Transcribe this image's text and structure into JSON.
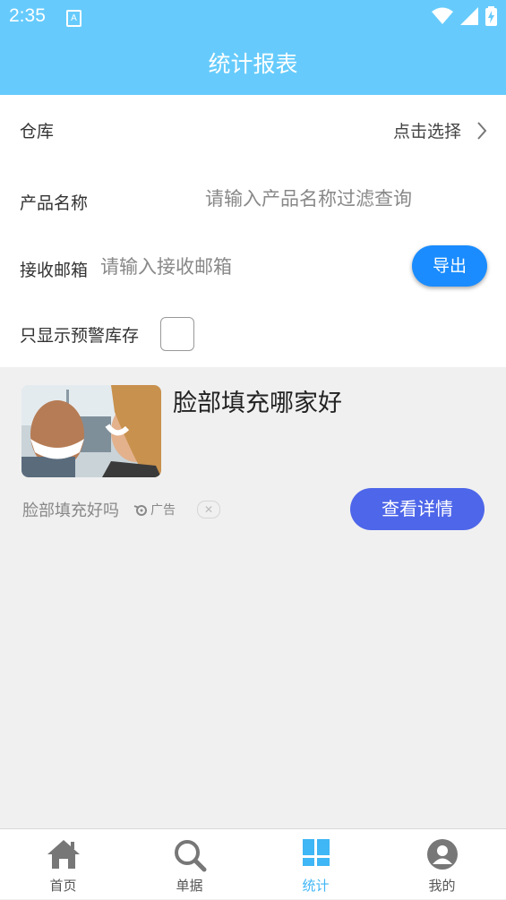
{
  "status_bar": {
    "time": "2:35",
    "notification_letter": "A"
  },
  "app_bar": {
    "title": "统计报表"
  },
  "form": {
    "warehouse": {
      "label": "仓库",
      "value": "点击选择"
    },
    "product_name": {
      "label": "产品名称",
      "placeholder": "请输入产品名称过滤查询"
    },
    "email": {
      "label": "接收邮箱",
      "placeholder": "请输入接收邮箱"
    },
    "export_button": "导出",
    "warning_stock": {
      "label": "只显示预警库存",
      "checked": false
    }
  },
  "ad": {
    "title": "脸部填充哪家好",
    "subtitle": "脸部填充好吗",
    "tag": "广告",
    "close_symbol": "✕",
    "button": "查看详情"
  },
  "bottom_nav": {
    "items": [
      {
        "label": "首页",
        "icon": "home-icon",
        "active": false
      },
      {
        "label": "单据",
        "icon": "search-icon",
        "active": false
      },
      {
        "label": "统计",
        "icon": "dashboard-icon",
        "active": true
      },
      {
        "label": "我的",
        "icon": "user-icon",
        "active": false
      }
    ]
  },
  "colors": {
    "primary": "#66cbfc",
    "export": "#1a8cff",
    "ad_button": "#4e66e9",
    "active_tab": "#3fb6f5"
  }
}
